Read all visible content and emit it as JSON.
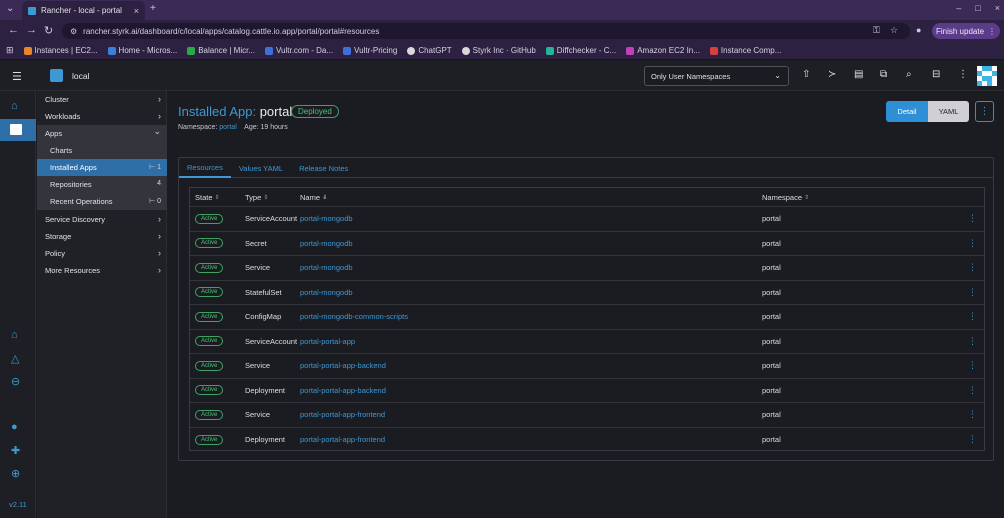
{
  "browser": {
    "tab_title": "Rancher - local - portal",
    "url": "rancher.styrk.ai/dashboard/c/local/apps/catalog.cattle.io.app/portal/portal#resources",
    "finish_update": "Finish update",
    "bookmarks": [
      {
        "label": "Instances | EC2...",
        "color": "#e8862c"
      },
      {
        "label": "Home - Micros...",
        "color": "#3b7fd6"
      },
      {
        "label": "Balance | Micr...",
        "color": "#2aa84a"
      },
      {
        "label": "Vultr.com - Da...",
        "color": "#3f6fd8"
      },
      {
        "label": "Vultr-Pricing",
        "color": "#3f6fd8"
      },
      {
        "label": "ChatGPT",
        "color": "#d8d8d8"
      },
      {
        "label": "Styrk Inc · GitHub",
        "color": "#d8d8d8"
      },
      {
        "label": "Diffchecker - C...",
        "color": "#27b39a"
      },
      {
        "label": "Amazon EC2 In...",
        "color": "#c33fb8"
      },
      {
        "label": "Instance Comp...",
        "color": "#d84040"
      }
    ]
  },
  "header": {
    "cluster": "local",
    "namespace_filter": "Only User Namespaces"
  },
  "sidebar": {
    "version": "v2.11",
    "items": [
      {
        "label": "Cluster",
        "arrow": "›"
      },
      {
        "label": "Workloads",
        "arrow": "›"
      },
      {
        "label": "Apps",
        "arrow": "⌄"
      },
      {
        "label": "Charts",
        "count": ""
      },
      {
        "label": "Installed Apps",
        "count": "⊢ 1"
      },
      {
        "label": "Repositories",
        "count": "4"
      },
      {
        "label": "Recent Operations",
        "count": "⊢ 0"
      },
      {
        "label": "Service Discovery",
        "arrow": "›"
      },
      {
        "label": "Storage",
        "arrow": "›"
      },
      {
        "label": "Policy",
        "arrow": "›"
      },
      {
        "label": "More Resources",
        "arrow": "›"
      }
    ]
  },
  "page": {
    "title_label": "Installed App:",
    "title_name": "portal",
    "status": "Deployed",
    "namespace_label": "Namespace:",
    "namespace_value": "portal",
    "age": "Age: 19 hours",
    "btn_detail": "Detail",
    "btn_yaml": "YAML"
  },
  "tabs": [
    "Resources",
    "Values YAML",
    "Release Notes"
  ],
  "table": {
    "headers": {
      "state": "State",
      "type": "Type",
      "name": "Name",
      "namespace": "Namespace"
    },
    "rows": [
      {
        "state": "Active",
        "type": "ServiceAccount",
        "name": "portal-mongodb",
        "namespace": "portal"
      },
      {
        "state": "Active",
        "type": "Secret",
        "name": "portal-mongodb",
        "namespace": "portal"
      },
      {
        "state": "Active",
        "type": "Service",
        "name": "portal-mongodb",
        "namespace": "portal"
      },
      {
        "state": "Active",
        "type": "StatefulSet",
        "name": "portal-mongodb",
        "namespace": "portal"
      },
      {
        "state": "Active",
        "type": "ConfigMap",
        "name": "portal-mongodb-common-scripts",
        "namespace": "portal"
      },
      {
        "state": "Active",
        "type": "ServiceAccount",
        "name": "portal-portal-app",
        "namespace": "portal"
      },
      {
        "state": "Active",
        "type": "Service",
        "name": "portal-portal-app-backend",
        "namespace": "portal"
      },
      {
        "state": "Active",
        "type": "Deployment",
        "name": "portal-portal-app-backend",
        "namespace": "portal"
      },
      {
        "state": "Active",
        "type": "Service",
        "name": "portal-portal-app-frontend",
        "namespace": "portal"
      },
      {
        "state": "Active",
        "type": "Deployment",
        "name": "portal-portal-app-frontend",
        "namespace": "portal"
      }
    ]
  }
}
